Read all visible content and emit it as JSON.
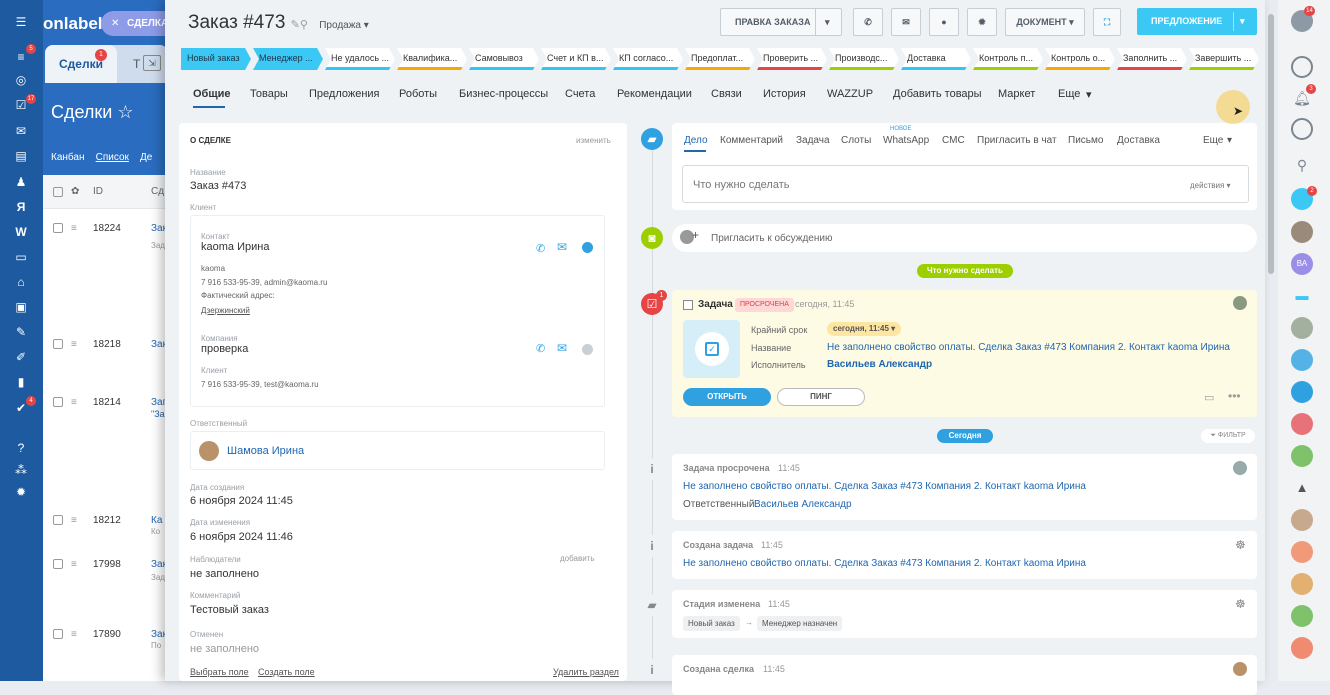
{
  "left_rail": {
    "badges": [
      "5",
      "17",
      "4"
    ]
  },
  "background": {
    "brand": "onlabel",
    "chip_label": "СДЕЛКА",
    "tab_active": "Сделки",
    "tab_badge": "1",
    "tab_next": "Т",
    "page_title": "Сделки",
    "view_kanban": "Канбан",
    "view_list": "Список",
    "view_more": "Де",
    "col_id": "ID",
    "col_name": "Сд",
    "rows": [
      {
        "id": "18224",
        "name": "Зак",
        "sub": "Зад"
      },
      {
        "id": "18218",
        "name": "Зак",
        "sub": ""
      },
      {
        "id": "18214",
        "name": "Зап",
        "sub": "\"За"
      },
      {
        "id": "18212",
        "name": "Ка",
        "sub": "Ко"
      },
      {
        "id": "17998",
        "name": "Зак",
        "sub": "Зад"
      },
      {
        "id": "17890",
        "name": "Зак",
        "sub": "По"
      }
    ]
  },
  "header": {
    "title": "Заказ #473",
    "category": "Продажа",
    "btn_pravka": "ПРАВКА ЗАКАЗА",
    "btn_document": "ДОКУМЕНТ",
    "btn_offer": "ПРЕДЛОЖЕНИЕ"
  },
  "stages": [
    {
      "label": "Новый заказ",
      "color": "#3bc8f5",
      "active": true
    },
    {
      "label": "Менеджер ...",
      "color": "#3bc8f5",
      "active": true
    },
    {
      "label": "Не удалось ...",
      "color": "#2fc6f6"
    },
    {
      "label": "Квалифика...",
      "color": "#f7a700"
    },
    {
      "label": "Самовывоз",
      "color": "#2fc6f6"
    },
    {
      "label": "Счет и КП в...",
      "color": "#2fc6f6"
    },
    {
      "label": "КП согласо...",
      "color": "#2fc6f6"
    },
    {
      "label": "Предоплат...",
      "color": "#f7a700"
    },
    {
      "label": "Проверить ...",
      "color": "#e64545"
    },
    {
      "label": "Производс...",
      "color": "#9dcf00"
    },
    {
      "label": "Доставка",
      "color": "#2fc6f6"
    },
    {
      "label": "Контроль п...",
      "color": "#9dcf00"
    },
    {
      "label": "Контроль о...",
      "color": "#f7a700"
    },
    {
      "label": "Заполнить ...",
      "color": "#e64545"
    },
    {
      "label": "Завершить ...",
      "color": "#9dcf00"
    }
  ],
  "tabs": [
    "Общие",
    "Товары",
    "Предложения",
    "Роботы",
    "Бизнес-процессы",
    "Счета",
    "Рекомендации",
    "Связи",
    "История",
    "WAZZUP",
    "Добавить товары",
    "Маркет",
    "Еще"
  ],
  "about": {
    "section_title": "О СДЕЛКЕ",
    "edit": "изменить",
    "name_label": "Название",
    "name_value": "Заказ #473",
    "client_label": "Клиент",
    "contact_label": "Контакт",
    "contact_name": "kaoma Ирина",
    "contact_company": "kaoma",
    "contact_info": "7 916 533-95-39, admin@kaoma.ru",
    "address_label": "Фактический адрес:",
    "address_value": "Дзержинский",
    "company_label": "Компания",
    "company_name": "проверка",
    "company_client_label": "Клиент",
    "company_info": "7 916 533-95-39, test@kaoma.ru",
    "responsible_label": "Ответственный",
    "responsible_name": "Шамова Ирина",
    "created_label": "Дата создания",
    "created_value": "6 ноября 2024 11:45",
    "modified_label": "Дата изменения",
    "modified_value": "6 ноября 2024 11:46",
    "observers_label": "Наблюдатели",
    "observers_add": "добавить",
    "observers_value": "не заполнено",
    "comment_label": "Комментарий",
    "comment_value": "Тестовый заказ",
    "cancelled_label": "Отменен",
    "cancelled_value": "не заполнено",
    "footer_select": "Выбрать поле",
    "footer_create": "Создать поле",
    "footer_delete": "Удалить раздел"
  },
  "composer": {
    "tabs": [
      "Дело",
      "Комментарий",
      "Задача",
      "Слоты",
      "WhatsApp",
      "СМС",
      "Пригласить в чат",
      "Письмо",
      "Доставка",
      "Еще"
    ],
    "new_badge": "новое",
    "placeholder": "Что нужно сделать",
    "actions": "действия"
  },
  "invite": "Пригласить к обсуждению",
  "todo_pill": "Что нужно сделать",
  "task": {
    "badge": "1",
    "title": "Задача",
    "status": "просрочена",
    "time": "сегодня, 11:45",
    "deadline_label": "Крайний срок",
    "deadline_value": "сегодня, 11:45",
    "name_label": "Название",
    "name_value": "Не заполнено свойство оплаты. Сделка Заказ #473 Компания 2. Контакт kaoma Ирина",
    "executor_label": "Исполнитель",
    "executor_value": "Васильев Александр",
    "open_btn": "ОТКРЫТЬ",
    "ping_btn": "ПИНГ"
  },
  "today_pill": "Сегодня",
  "filter": "ФИЛЬТР",
  "history": [
    {
      "title": "Задача просрочена",
      "time": "11:45",
      "line1": "Не заполнено свойство оплаты. Сделка Заказ #473 Компания 2. Контакт kaoma Ирина",
      "resp_label": "Ответственный",
      "resp_value": "Васильев Александр"
    },
    {
      "title": "Создана задача",
      "time": "11:45",
      "line1": "Не заполнено свойство оплаты. Сделка Заказ #473 Компания 2. Контакт kaoma Ирина"
    },
    {
      "title": "Стадия изменена",
      "time": "11:45",
      "from": "Новый заказ",
      "to": "Менеджер назначен"
    },
    {
      "title": "Создана сделка",
      "time": "11:45"
    }
  ],
  "right_rail": {
    "badges": [
      "14",
      "3",
      "2"
    ],
    "avatar_initials": "ВА"
  }
}
